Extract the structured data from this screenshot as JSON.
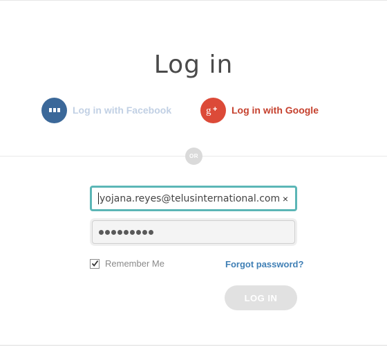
{
  "page": {
    "title": "Log in"
  },
  "social": {
    "facebook_label": "Log in with Facebook",
    "google_label": "Log in with Google",
    "facebook_icon": "facebook-icon",
    "google_icon": "google-plus-icon",
    "facebook_color": "#3b6899",
    "google_color": "#dc4a38"
  },
  "divider": {
    "or_label": "OR"
  },
  "form": {
    "email_value": "yojana.reyes@telusinternational.com",
    "clear_symbol": "×",
    "password_length": 9,
    "remember_label": "Remember Me",
    "remember_checked": true,
    "forgot_label": "Forgot password?",
    "login_label": "LOG IN"
  },
  "colors": {
    "accent_focus": "#5bb6b6",
    "link": "#3f7fb5",
    "button_disabled": "#e1e1e1"
  }
}
